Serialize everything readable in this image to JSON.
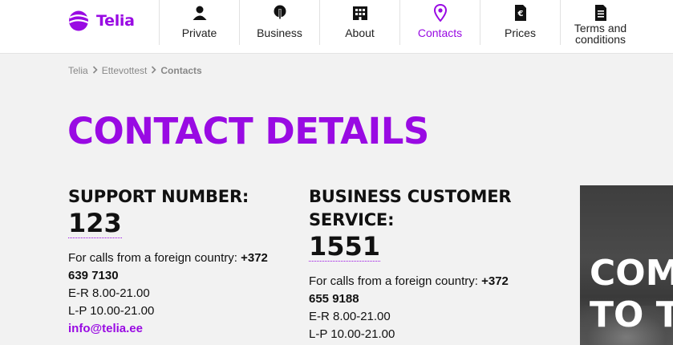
{
  "brand": {
    "name": "Telia",
    "accent": "#990ae3"
  },
  "nav": {
    "items": [
      {
        "label": "Private",
        "icon": "person-icon"
      },
      {
        "label": "Business",
        "icon": "business-icon"
      },
      {
        "label": "About",
        "icon": "building-icon"
      },
      {
        "label": "Contacts",
        "icon": "location-pin-icon",
        "active": true
      },
      {
        "label": "Prices",
        "icon": "euro-document-icon"
      },
      {
        "label": "Terms and conditions",
        "icon": "document-icon"
      }
    ]
  },
  "breadcrumb": {
    "items": [
      "Telia",
      "Ettevottest"
    ],
    "current": "Contacts"
  },
  "page": {
    "title": "CONTACT DETAILS"
  },
  "support": {
    "heading": "SUPPORT NUMBER:",
    "number": "123",
    "foreign_label": "For calls from a foreign country:",
    "foreign_number_part1": "+372",
    "foreign_number_part2": "639 7130",
    "hours_weekdays": "E-R 8.00-21.00",
    "hours_weekend": "L-P 10.00-21.00",
    "email": "info@telia.ee"
  },
  "business": {
    "heading_line1": "BUSINESS CUSTOMER",
    "heading_line2": "SERVICE:",
    "number": "1551",
    "foreign_label": "For calls from a foreign country:",
    "foreign_number_part1": "+372",
    "foreign_number_part2": "655 9188",
    "hours_weekdays": "E-R 8.00-21.00",
    "hours_weekend": "L-P 10.00-21.00"
  },
  "promo": {
    "line1": "COM",
    "line2": "TO T"
  }
}
